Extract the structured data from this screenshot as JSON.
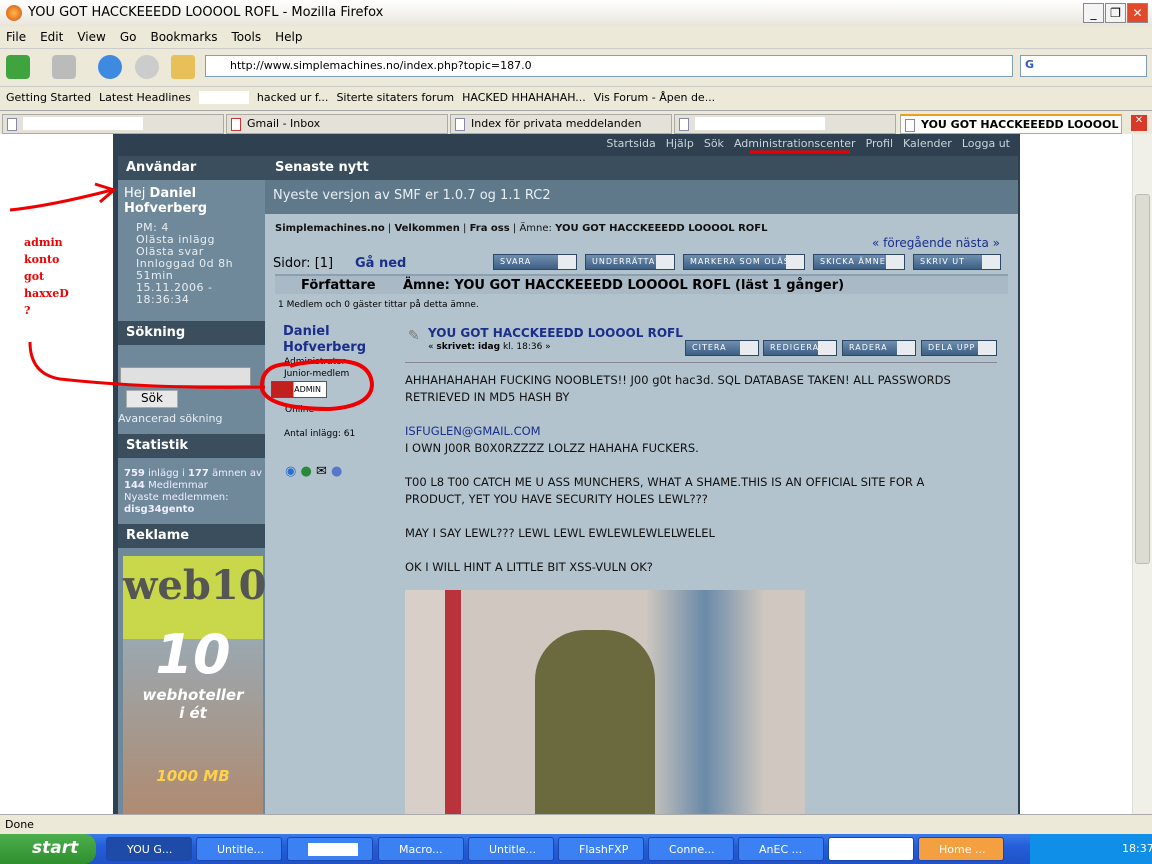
{
  "window": {
    "title": "YOU GOT HACCKEEEDD LOOOOL ROFL - Mozilla Firefox"
  },
  "menu": [
    "File",
    "Edit",
    "View",
    "Go",
    "Bookmarks",
    "Tools",
    "Help"
  ],
  "address": {
    "url": "http://www.simplemachines.no/index.php?topic=187.0",
    "search_engine": "G"
  },
  "bookmarks": [
    "Getting Started",
    "Latest Headlines",
    "hacked ur f...",
    "Siterte sitaters forum",
    "HACKED HHAHAHAH...",
    "Vis Forum - Åpen de..."
  ],
  "tabs": [
    "",
    "Gmail - Inbox",
    "Index för privata meddelanden",
    "",
    "YOU GOT HACCKEEEDD LOOOOL R..."
  ],
  "forum": {
    "topnav": [
      "Startsida",
      "Hjälp",
      "Sök",
      "Administrationscenter",
      "Profil",
      "Kalender",
      "Logga ut"
    ],
    "sidebar": {
      "users_title": "Användar",
      "greeting": "Hej",
      "username": "Daniel Hofverberg",
      "items": [
        "PM: 4",
        "Olästa inlägg",
        "Olästa svar",
        "Innloggad 0d 8h 51min",
        "15.11.2006 - 18:36:34"
      ],
      "search_title": "Sökning",
      "search_button": "Sök",
      "advanced_search": "Avancerad sökning",
      "stats_title": "Statistik",
      "stats_posts": "759",
      "stats_text1": "inlägg i",
      "stats_topics": "177",
      "stats_text2": "ämnen av",
      "stats_members": "144",
      "stats_text3": "Medlemmar",
      "newest_label": "Nyaste medlemmen:",
      "newest_member": "disg34gento",
      "ads_title": "Reklame",
      "ad": {
        "brand": "web10",
        "number": "10",
        "line1": "webhoteller",
        "line2": "i ét",
        "size": "1000 MB"
      }
    },
    "news_title": "Senaste nytt",
    "news": "Nyeste versjon av SMF er 1.0.7 og 1.1 RC2",
    "breadcrumb": [
      "Simplemachines.no",
      "Velkommen",
      "Fra oss"
    ],
    "breadcrumb_topic_label": "Ämne:",
    "breadcrumb_topic": "YOU GOT HACCKEEEDD LOOOOL ROFL",
    "prevnext": "« föregående nästa »",
    "pages_label": "Sidor:",
    "pages_value": "[1]",
    "go_down": "Gå ned",
    "buttons": [
      "SVARA",
      "UNDERRÄTTA",
      "MARKERA SOM OLÄST",
      "SKICKA ÄMNE",
      "SKRIV UT"
    ],
    "author_header": "Författare",
    "topic_header": "Ämne: YOU GOT HACCKEEEDD LOOOOL ROFL  (läst 1 gånger)",
    "viewers": "1 Medlem och 0 gäster tittar på detta ämne.",
    "poster": {
      "name": "Daniel Hofverberg",
      "group": "Administrator",
      "rank": "Junior-medlem",
      "badge": "ADMIN",
      "status": "Online",
      "posts": "Antal inlägg: 61"
    },
    "post": {
      "title": "YOU GOT HACCKEEEDD LOOOOL ROFL",
      "meta_prefix": "«",
      "meta_written": "skrivet:",
      "meta_day": "idag",
      "meta_time": "kl. 18:36 »",
      "buttons": [
        "CITERA",
        "REDIGERA",
        "RADERA",
        "DELA UPP"
      ],
      "body": [
        "AHHAHAHAHAH FUCKING NOOBLETS!! J00 g0t hac3d. SQL DATABASE TAKEN! ALL PASSWORDS RETRIEVED IN MD5 HASH BY",
        "ISFUGLEN@GMAIL.COM",
        "I OWN J00R B0X0RZZZZ LOLZZ HAHAHA FUCKERS.",
        "T00 L8 T00 CATCH ME U ASS MUNCHERS, WHAT A SHAME.THIS IS AN  OFFICIAL SITE FOR A PRODUCT, YET YOU HAVE SECURITY HOLES LEWL???",
        "MAY I SAY LEWL??? LEWL LEWL EWLEWLEWLELWELEL",
        "OK I WILL HINT A LITTLE BIT XSS-VULN OK?"
      ]
    }
  },
  "annotation": {
    "text": "admin konto got haxxeD ?",
    "color": "#e00000"
  },
  "status": "Done",
  "taskbar": {
    "start": "start",
    "items": [
      "YOU G...",
      "Untitle...",
      "",
      "Macro...",
      "Untitle...",
      "FlashFXP",
      "Conne...",
      "AnEC ...",
      "",
      "Home ..."
    ],
    "clock": "18:37"
  }
}
